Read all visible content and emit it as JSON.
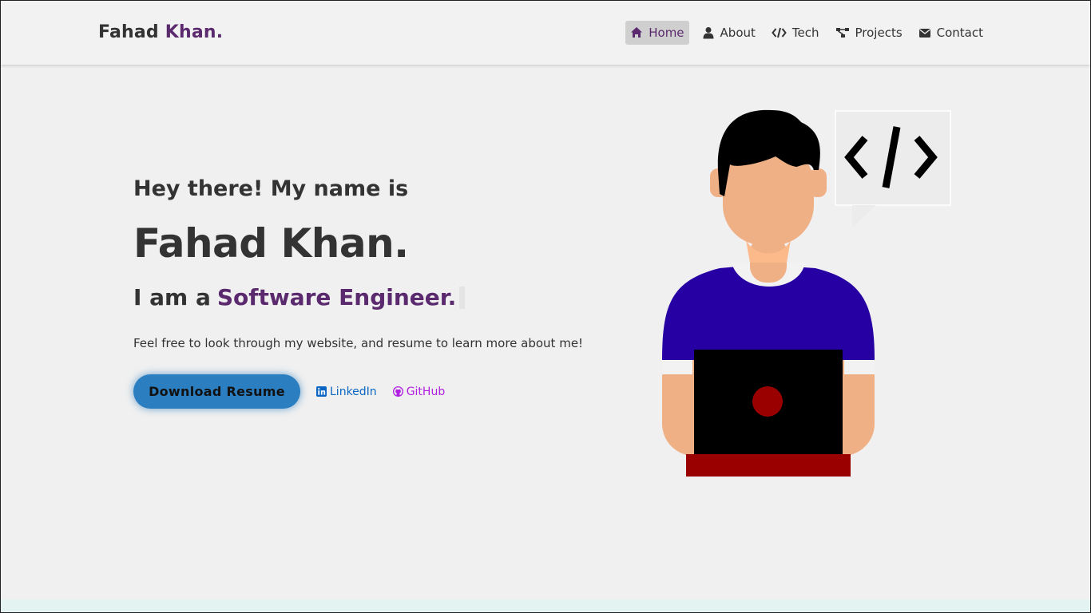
{
  "brand": {
    "first": "Fahad",
    "last": "Khan."
  },
  "nav": {
    "items": [
      {
        "label": "Home",
        "icon": "home-icon",
        "active": true
      },
      {
        "label": "About",
        "icon": "user-icon",
        "active": false
      },
      {
        "label": "Tech",
        "icon": "code-icon",
        "active": false
      },
      {
        "label": "Projects",
        "icon": "project-diagram-icon",
        "active": false
      },
      {
        "label": "Contact",
        "icon": "envelope-icon",
        "active": false
      }
    ]
  },
  "hero": {
    "greeting": "Hey there! My name is",
    "name": "Fahad Khan.",
    "role_prefix": "I am a",
    "role_title": "Software Engineer.",
    "description": "Feel free to look through my website, and resume to learn more about me!",
    "resume_button": "Download Resume",
    "linkedin": "LinkedIn",
    "github": "GitHub"
  },
  "colors": {
    "accent": "#5b2a6e",
    "button": "#2b7ec0",
    "linkedin": "#0a66c2",
    "github": "#b01ee0",
    "shirt": "#2700a3",
    "skin": "#f0b086",
    "laptop_base": "#9b0000"
  }
}
